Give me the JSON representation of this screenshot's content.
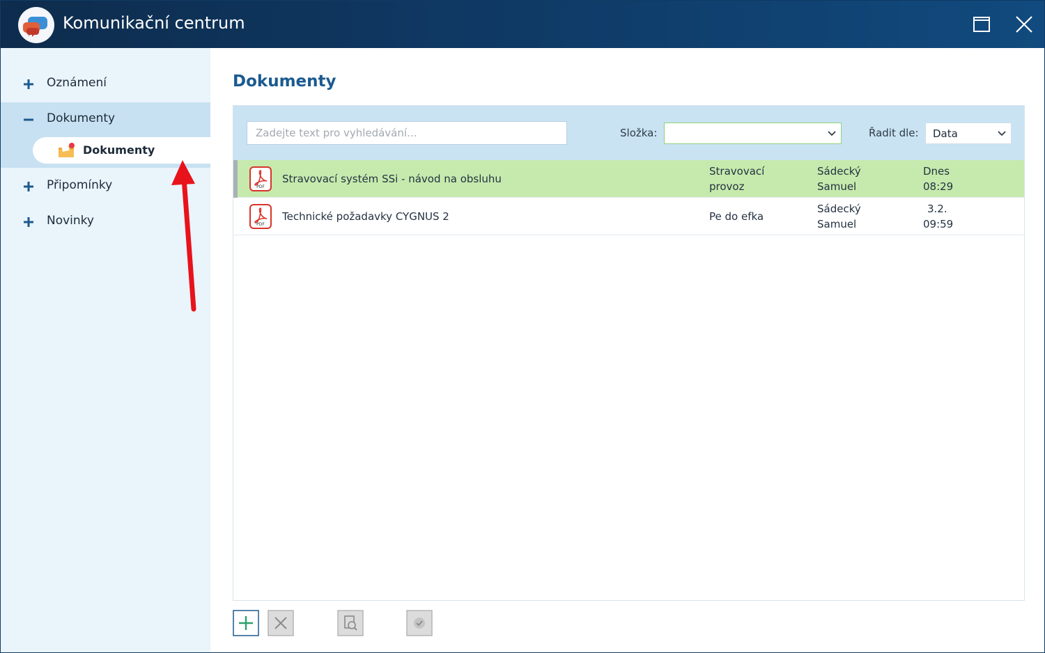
{
  "window": {
    "title": "Komunikační centrum"
  },
  "sidebar": {
    "items": [
      {
        "label": "Oznámení",
        "glyph": "plus",
        "active": false
      },
      {
        "label": "Dokumenty",
        "glyph": "minus",
        "active": true
      },
      {
        "label": "Připomínky",
        "glyph": "plus",
        "active": false
      },
      {
        "label": "Novinky",
        "glyph": "plus",
        "active": false
      }
    ],
    "subitem": {
      "label": "Dokumenty",
      "icon": "folder-icon"
    }
  },
  "main": {
    "title": "Dokumenty",
    "search": {
      "placeholder": "Zadejte text pro vyhledávání...",
      "value": ""
    },
    "folder": {
      "label": "Složka:",
      "value": ""
    },
    "sort": {
      "label": "Řadit dle:",
      "value": "Data"
    },
    "documents": [
      {
        "name": "Stravovací systém SSi - návod na obsluhu",
        "folder": "Stravovací provoz",
        "author": "Sádecký Samuel",
        "date_line1": "Dnes",
        "date_line2": "08:29",
        "selected": true,
        "icon": "pdf-icon"
      },
      {
        "name": "Technické požadavky CYGNUS 2",
        "folder": "Pe do efka",
        "author": "Sádecký Samuel",
        "date_line1": "3.2.",
        "date_line2": "09:59",
        "selected": false,
        "icon": "pdf-icon"
      }
    ],
    "toolbar": {
      "add_icon": "plus-icon",
      "delete_icon": "x-icon",
      "preview_icon": "magnifier-doc-icon",
      "confirm_icon": "check-icon"
    }
  },
  "colors": {
    "titlebar": "#0f3a66",
    "accent": "#1b5a8f",
    "selected_row": "#c6eaad",
    "annotation_arrow": "#e8121b"
  }
}
